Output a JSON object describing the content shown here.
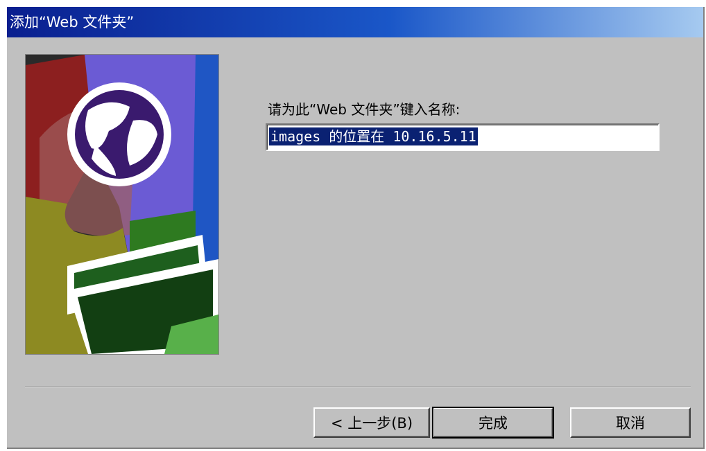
{
  "window": {
    "title": "添加“Web 文件夹”"
  },
  "illustration": {
    "icon": "globe-folder-wizard-art",
    "colors": {
      "red": "#8c1f1f",
      "purple": "#6b5bd4",
      "blue": "#1f56c4",
      "olive": "#8d8a22",
      "green": "#1e5f1e",
      "light_green": "#58b04a"
    }
  },
  "form": {
    "prompt": "请为此“Web 文件夹”键入名称:",
    "name_value": "images 的位置在 10.16.5.11"
  },
  "buttons": {
    "back": "< 上一步(B)",
    "finish": "完成",
    "cancel": "取消"
  }
}
